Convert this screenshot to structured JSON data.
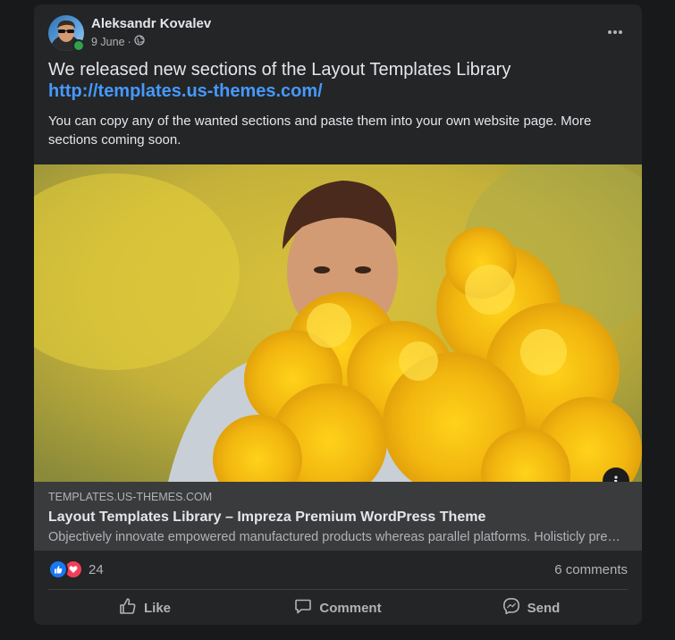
{
  "post": {
    "author": "Aleksandr Kovalev",
    "date": "9 June",
    "date_separator": "·",
    "audience_icon": "globe-icon",
    "more_icon": "more-horizontal-icon",
    "headline": "We released new sections of the Layout Templates Library",
    "link": "http://templates.us-themes.com/",
    "body": "You can copy any of the wanted sections and paste them into your own website page. More sections coming soon."
  },
  "link_preview": {
    "domain": "TEMPLATES.US-THEMES.COM",
    "title": "Layout Templates Library – Impreza Premium WordPress Theme",
    "description": "Objectively innovate empowered manufactured products whereas parallel platforms. Holisticly predominate extensible testing procedures for reliable supply chains.",
    "info_icon": "info-icon"
  },
  "stats": {
    "reaction_icons": [
      "like-reaction-icon",
      "love-reaction-icon"
    ],
    "reaction_count": "24",
    "comments": "6 comments"
  },
  "actions": [
    {
      "label": "Like",
      "icon": "thumbs-up-icon"
    },
    {
      "label": "Comment",
      "icon": "comment-icon"
    },
    {
      "label": "Send",
      "icon": "messenger-icon"
    }
  ],
  "colors": {
    "page_bg": "#18191a",
    "card_bg": "#242526",
    "preview_bg": "#3a3b3c",
    "text_primary": "#e4e6eb",
    "text_secondary": "#b0b3b8",
    "link": "#4599ff",
    "like_blue": "#1877f2",
    "love_red": "#f33e58",
    "online_green": "#31a24c"
  }
}
